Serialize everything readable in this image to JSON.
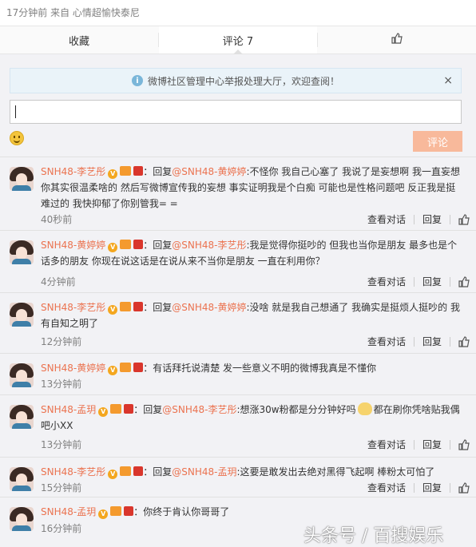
{
  "top_status": "17分钟前 来自 心情超愉快泰尼",
  "tabs": {
    "favorite": "收藏",
    "comment": "评论 7"
  },
  "notice": "微博社区管理中心举报处理大厅，欢迎查阅！",
  "notice_close": "×",
  "submit_label": "评论",
  "actions": {
    "view_thread": "查看对话",
    "reply": "回复"
  },
  "comments": [
    {
      "user": "SNH48-李艺彤",
      "reply_prefix": "：回复",
      "mention": "@SNH48-黄婷婷",
      "text": ":不怪你 我自己心塞了 我说了是妄想啊 我一直妄想你其实很温柔啥的 然后写微博宣传我的妄想 事实证明我是个白痴 可能也是性格问题吧 反正我是挺难过的 我快抑郁了你别管我= =",
      "time": "40秒前"
    },
    {
      "user": "SNH48-黄婷婷",
      "reply_prefix": "：回复",
      "mention": "@SNH48-李艺彤",
      "text": ":我是觉得你挺吵的 但我也当你是朋友 最多也是个话多的朋友 你现在说这话是在说从来不当你是朋友 一直在利用你？",
      "time": "4分钟前"
    },
    {
      "user": "SNH48-李艺彤",
      "reply_prefix": "：回复",
      "mention": "@SNH48-黄婷婷",
      "text": ":没啥 就是我自己想通了 我确实是挺烦人挺吵的 我有自知之明了",
      "time": "12分钟前"
    },
    {
      "user": "SNH48-黄婷婷",
      "reply_prefix": "：",
      "mention": "",
      "text": "有话拜托说清楚 发一些意义不明的微博我真是不懂你",
      "time": "13分钟前"
    },
    {
      "user": "SNH48-孟玥",
      "reply_prefix": "：回复",
      "mention": "@SNH48-李艺彤",
      "text": ":想涨30w粉都是分分钟好吗",
      "text2": "都在刷你凭啥贴我偶吧小XX",
      "time": "13分钟前"
    },
    {
      "user": "SNH48-李艺彤",
      "reply_prefix": "：回复",
      "mention": "@SNH48-孟玥",
      "text": ":这要是敢发出去绝对黑得飞起啊 棒粉太可怕了",
      "time": "15分钟前"
    },
    {
      "user": "SNH48-孟玥",
      "reply_prefix": "：",
      "mention": "",
      "text": "你终于肯认你哥哥了",
      "time": "16分钟前"
    }
  ],
  "watermark": "头条号 / 百搜娱乐",
  "colors": {
    "name": "#eb7350",
    "submit_bg": "#f8b99b",
    "panel_bg": "#f2f2f5"
  }
}
